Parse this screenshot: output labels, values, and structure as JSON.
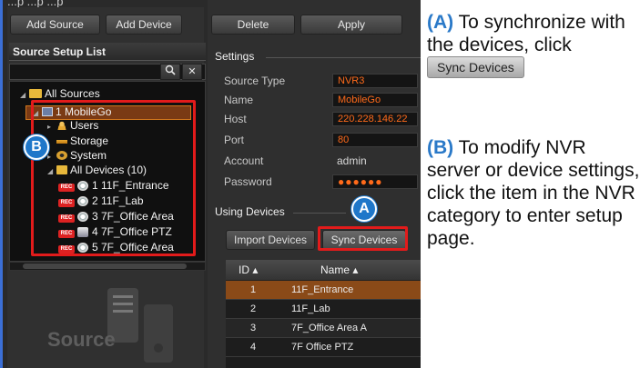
{
  "toolbar": {
    "add_source": "Add Source",
    "add_device": "Add Device",
    "delete": "Delete",
    "apply": "Apply"
  },
  "top_partial_text": "...p ...p ...p",
  "source_list": {
    "title": "Source Setup List",
    "search_icon": "magnifier-icon",
    "clear_icon": "close-icon",
    "tree": {
      "root": "All Sources",
      "nvr": "1 MobileGo",
      "users": "Users",
      "storage": "Storage",
      "system": "System",
      "all_devices": "All Devices (10)",
      "rec_badge": "REC",
      "devices": [
        "1 11F_Entrance",
        "2 11F_Lab",
        "3 7F_Office Area",
        "4 7F_Office PTZ",
        "5 7F_Office Area"
      ]
    },
    "logo_text": "Source"
  },
  "settings": {
    "title": "Settings",
    "fields": [
      {
        "label": "Source Type",
        "value": "NVR3"
      },
      {
        "label": "Name",
        "value": "MobileGo"
      },
      {
        "label": "Host",
        "value": "220.228.146.22"
      },
      {
        "label": "Port",
        "value": "80"
      },
      {
        "label": "Account",
        "value": "admin"
      },
      {
        "label": "Password",
        "value": "●●●●●●"
      }
    ]
  },
  "using_devices": {
    "title": "Using Devices",
    "import_button": "Import Devices",
    "sync_button": "Sync Devices",
    "table": {
      "col_id": "ID ▴",
      "col_name": "Name ▴",
      "rows": [
        {
          "id": "1",
          "name": "11F_Entrance"
        },
        {
          "id": "2",
          "name": "11F_Lab"
        },
        {
          "id": "3",
          "name": "7F_Office Area A"
        },
        {
          "id": "4",
          "name": "7F Office PTZ"
        }
      ]
    }
  },
  "callouts": {
    "a_badge": "A",
    "b_badge": "B",
    "a_tag": "(A)",
    "a_text1": " To synchronize with the devices, click ",
    "a_button": "Sync Devices",
    "b_tag": "(B)",
    "b_text": " To modify NVR server or device settings, click the item in the NVR category to enter setup page."
  },
  "colors": {
    "highlight_red": "#e21b1b",
    "badge_blue": "#1f77c9",
    "value_orange": "#ff6a1a",
    "selected_row": "#7a3a14"
  }
}
